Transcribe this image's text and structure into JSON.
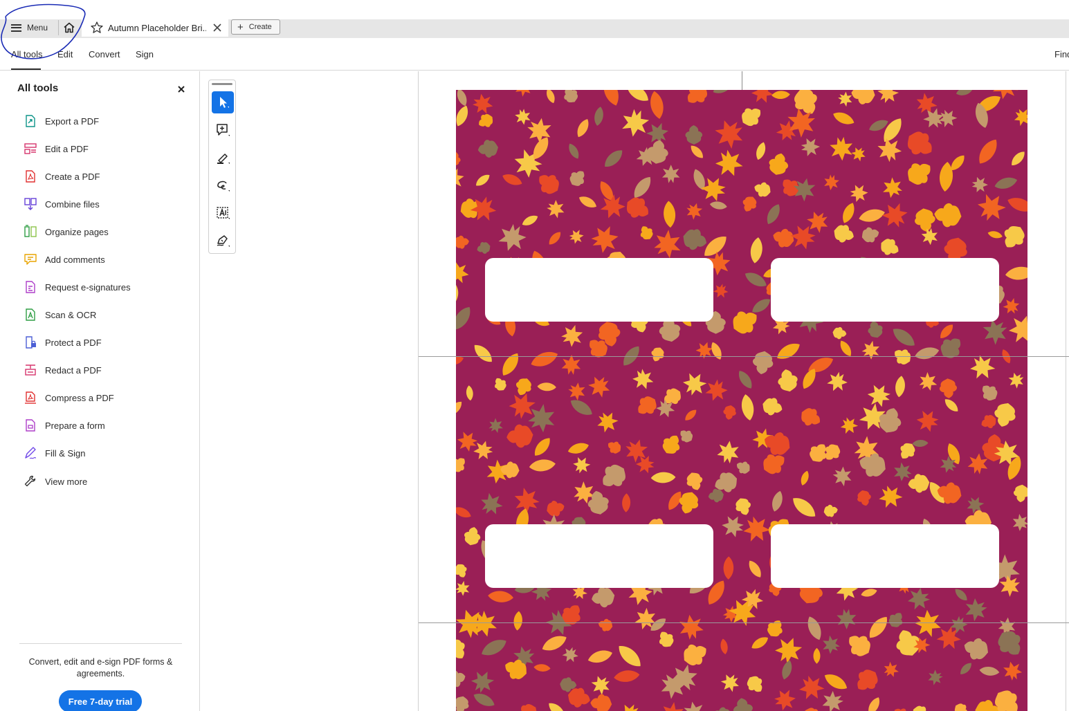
{
  "window": {
    "menu_label": "Menu",
    "document_tab_title": "Autumn Placeholder Bri...",
    "create_label": "Create"
  },
  "menubar": {
    "tabs": [
      {
        "label": "All tools",
        "active": true
      },
      {
        "label": "Edit"
      },
      {
        "label": "Convert"
      },
      {
        "label": "Sign"
      }
    ],
    "find_label": "Find"
  },
  "side_panel": {
    "title": "All tools",
    "items": [
      {
        "label": "Export a PDF",
        "icon": "export-pdf-icon",
        "color": "#0d9488"
      },
      {
        "label": "Edit a PDF",
        "icon": "edit-pdf-icon",
        "color": "#d6336c"
      },
      {
        "label": "Create a PDF",
        "icon": "create-pdf-icon",
        "color": "#e03131"
      },
      {
        "label": "Combine files",
        "icon": "combine-files-icon",
        "color": "#6741d9"
      },
      {
        "label": "Organize pages",
        "icon": "organize-pages-icon",
        "color": "#2f9e44"
      },
      {
        "label": "Add comments",
        "icon": "add-comments-icon",
        "color": "#e8a400"
      },
      {
        "label": "Request e-signatures",
        "icon": "request-esignatures-icon",
        "color": "#ae3ec9"
      },
      {
        "label": "Scan & OCR",
        "icon": "scan-ocr-icon",
        "color": "#2f9e44"
      },
      {
        "label": "Protect a PDF",
        "icon": "protect-pdf-icon",
        "color": "#4c5fd5"
      },
      {
        "label": "Redact a PDF",
        "icon": "redact-pdf-icon",
        "color": "#d6336c"
      },
      {
        "label": "Compress a PDF",
        "icon": "compress-pdf-icon",
        "color": "#e03131"
      },
      {
        "label": "Prepare a form",
        "icon": "prepare-form-icon",
        "color": "#ae3ec9"
      },
      {
        "label": "Fill & Sign",
        "icon": "fill-sign-icon",
        "color": "#7048e8"
      },
      {
        "label": "View more",
        "icon": "wrench-icon",
        "color": "#333333"
      }
    ],
    "promo_text": "Convert, edit and e-sign PDF forms & agreements.",
    "trial_button": "Free 7-day trial"
  },
  "toolbar": {
    "tools": [
      {
        "name": "select-tool",
        "icon": "cursor-arrow-icon",
        "selected": true
      },
      {
        "name": "add-comment-tool",
        "icon": "comment-plus-icon"
      },
      {
        "name": "highlight-tool",
        "icon": "highlighter-pen-icon"
      },
      {
        "name": "draw-tool",
        "icon": "freehand-loop-icon"
      },
      {
        "name": "edit-text-tool",
        "icon": "text-frame-icon"
      },
      {
        "name": "sign-tool",
        "icon": "signature-pen-icon"
      }
    ]
  },
  "document": {
    "background_color": "#9a1f56",
    "leaf_colors": [
      "#f7a81b",
      "#f26522",
      "#f7c948",
      "#c49a6c",
      "#8b7355",
      "#e84a27",
      "#fbb040"
    ],
    "label_count": 4
  },
  "colors": {
    "accent": "#1473e6",
    "annotation_ink": "#1a2bb5"
  }
}
